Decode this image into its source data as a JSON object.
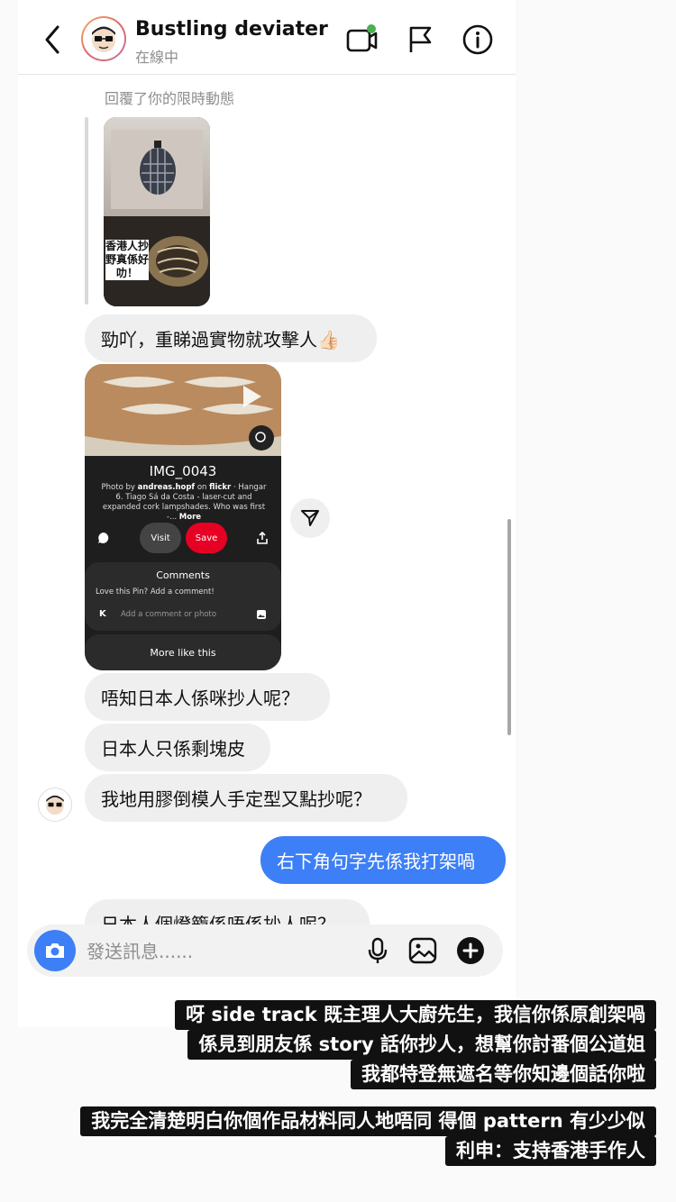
{
  "header": {
    "contact_name": "Bustling deviater",
    "contact_status": "在線中"
  },
  "chat": {
    "reply_note": "回覆了你的限時動態",
    "story_caption": "香港人抄野真係好叻！",
    "messages": [
      {
        "text": "勁吖，重睇過實物就攻擊人👍🏻"
      },
      {
        "text": "唔知日本人係咪抄人呢？"
      },
      {
        "text": "日本人只係剩塊皮"
      },
      {
        "text": "我地用膠倒模人手定型又點抄呢？"
      },
      {
        "text": "右下角句字先係我打架喎"
      },
      {
        "text": "日本人個燈籠係唔係抄人呢？"
      }
    ],
    "pin_card": {
      "title": "IMG_0043",
      "desc_prefix": "Photo by ",
      "desc_author": "andreas.hopf",
      "desc_on": " on ",
      "desc_source": "flickr",
      "desc_rest": " · Hangar 6. Tiago Sá da Costa - laser-cut and expanded cork lampshades. Who was first -... ",
      "desc_more": "More",
      "visit_label": "Visit",
      "save_label": "Save",
      "comments_title": "Comments",
      "comments_prompt": "Love this Pin? Add a comment!",
      "comment_avatar_letter": "K",
      "comment_placeholder": "Add a comment or photo",
      "more_like_this": "More like this"
    }
  },
  "composer": {
    "placeholder": "發送訊息......"
  },
  "captions": {
    "block1": [
      "呀 side track 既主理人大廚先生，我信你係原創架喎",
      "係見到朋友係 story 話你抄人，想幫你討番個公道姐",
      "我都特登無遮名等你知邊個話你啦"
    ],
    "block2": [
      "我完全清楚明白你個作品材料同人地唔同 得個 pattern 有少少似",
      "利申：支持香港手作人"
    ]
  },
  "colors": {
    "accent": "#3d7ff6",
    "online": "#4caf50",
    "save_red": "#e60023"
  }
}
